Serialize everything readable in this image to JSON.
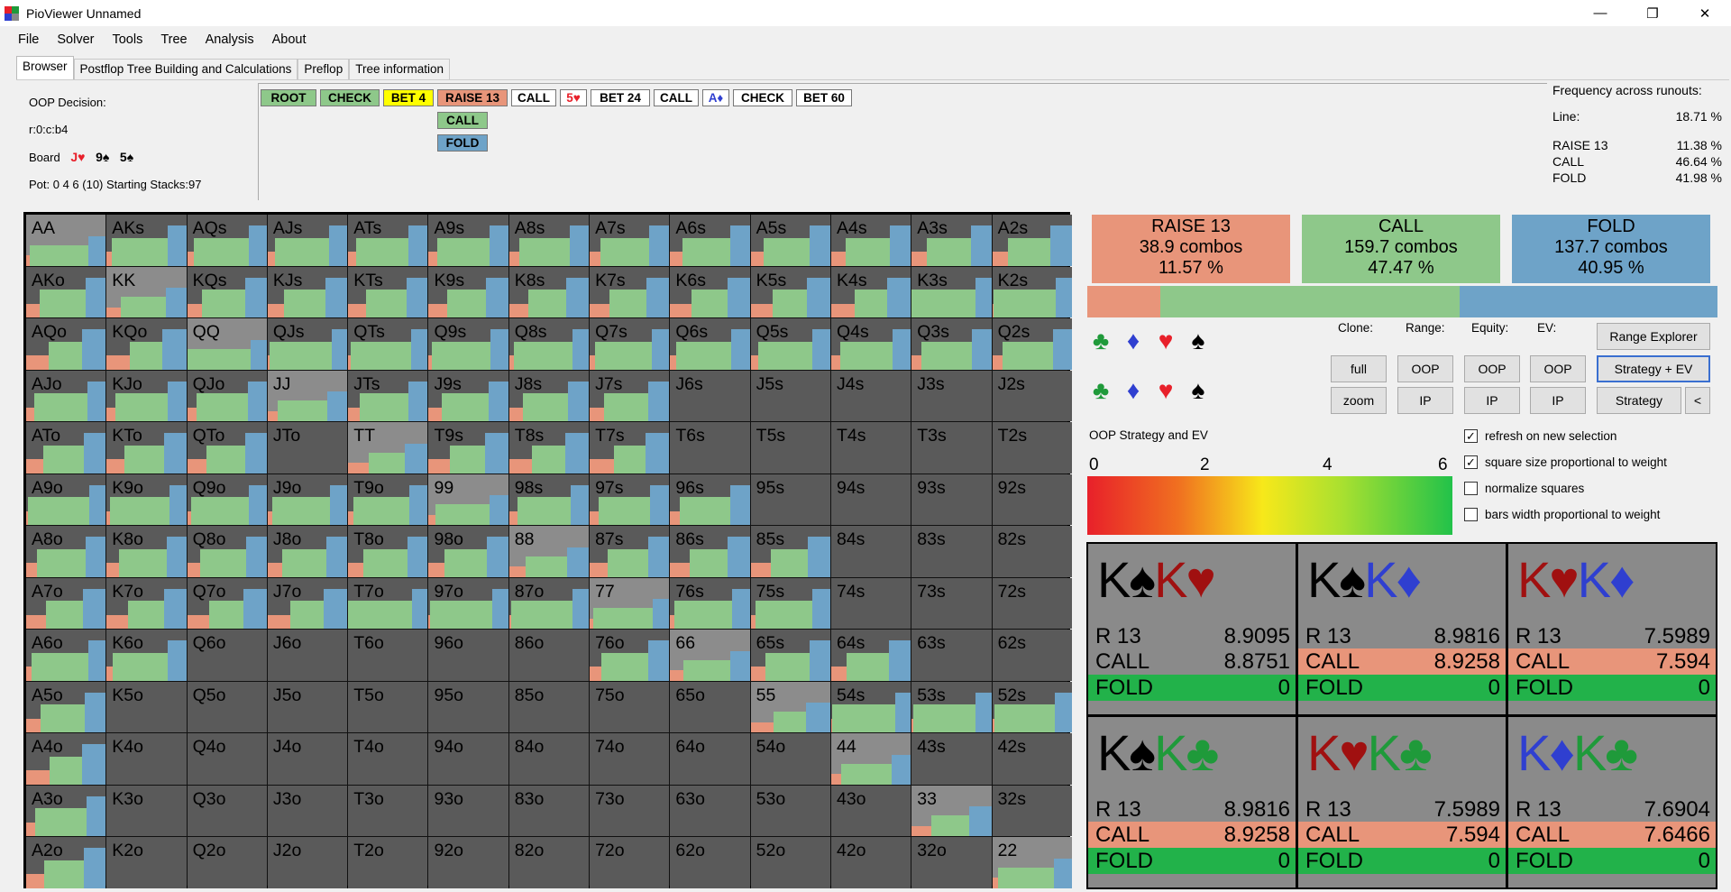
{
  "window": {
    "title": "PioViewer Unnamed",
    "minimize": "—",
    "restore": "❐",
    "close": "✕"
  },
  "menu": [
    "File",
    "Solver",
    "Tools",
    "Tree",
    "Analysis",
    "About"
  ],
  "tabs": [
    "Browser",
    "Postflop Tree Building and Calculations",
    "Preflop",
    "Tree information"
  ],
  "info": {
    "decision": "OOP Decision:",
    "line": "r:0:c:b4",
    "board_label": "Board",
    "board": [
      {
        "card": "J♥",
        "color": "#e8202a"
      },
      {
        "card": "9♠",
        "color": "#000000"
      },
      {
        "card": "5♠",
        "color": "#000000"
      }
    ],
    "pot": "Pot: 0 4 6 (10) Starting Stacks:97"
  },
  "path": [
    {
      "label": "ROOT",
      "bg": "#8ec88a",
      "fg": "#000000"
    },
    {
      "label": "CHECK",
      "bg": "#8ec88a",
      "fg": "#000000"
    },
    {
      "label": "BET 4",
      "bg": "#ffff00",
      "fg": "#000000"
    },
    {
      "label": "RAISE 13",
      "bg": "#e8957a",
      "fg": "#000000"
    },
    {
      "label": "CALL",
      "bg": "#ffffff",
      "fg": "#000000"
    },
    {
      "label": "5♥",
      "bg": "#ffffff",
      "fg": "#e8202a"
    },
    {
      "label": "BET 24",
      "bg": "#ffffff",
      "fg": "#000000"
    },
    {
      "label": "CALL",
      "bg": "#ffffff",
      "fg": "#000000"
    },
    {
      "label": "A♦",
      "bg": "#ffffff",
      "fg": "#2f3fd0"
    },
    {
      "label": "CHECK",
      "bg": "#ffffff",
      "fg": "#000000"
    },
    {
      "label": "BET 60",
      "bg": "#ffffff",
      "fg": "#000000"
    }
  ],
  "path_options": [
    {
      "label": "CALL",
      "bg": "#8ec88a"
    },
    {
      "label": "FOLD",
      "bg": "#6ea3c8"
    }
  ],
  "frequency": {
    "title": "Frequency across runouts:",
    "line_label": "Line:",
    "line_value": "18.71 %",
    "rows": [
      {
        "label": "RAISE 13",
        "value": "11.38 %"
      },
      {
        "label": "CALL",
        "value": "46.64 %"
      },
      {
        "label": "FOLD",
        "value": "41.98 %"
      }
    ]
  },
  "colors": {
    "raise": "#e8957a",
    "call": "#8ec88a",
    "fold": "#6ea3c8",
    "empty": "#5a5a5a",
    "weight": "#8c8c8c"
  },
  "matrix": [
    [
      "AA",
      "AKs",
      "AQs",
      "AJs",
      "ATs",
      "A9s",
      "A8s",
      "A7s",
      "A6s",
      "A5s",
      "A4s",
      "A3s",
      "A2s"
    ],
    [
      "AKo",
      "KK",
      "KQs",
      "KJs",
      "KTs",
      "K9s",
      "K8s",
      "K7s",
      "K6s",
      "K5s",
      "K4s",
      "K3s",
      "K2s"
    ],
    [
      "AQo",
      "KQo",
      "QQ",
      "QJs",
      "QTs",
      "Q9s",
      "Q8s",
      "Q7s",
      "Q6s",
      "Q5s",
      "Q4s",
      "Q3s",
      "Q2s"
    ],
    [
      "AJo",
      "KJo",
      "QJo",
      "JJ",
      "JTs",
      "J9s",
      "J8s",
      "J7s",
      "J6s",
      "J5s",
      "J4s",
      "J3s",
      "J2s"
    ],
    [
      "ATo",
      "KTo",
      "QTo",
      "JTo",
      "TT",
      "T9s",
      "T8s",
      "T7s",
      "T6s",
      "T5s",
      "T4s",
      "T3s",
      "T2s"
    ],
    [
      "A9o",
      "K9o",
      "Q9o",
      "J9o",
      "T9o",
      "99",
      "98s",
      "97s",
      "96s",
      "95s",
      "94s",
      "93s",
      "92s"
    ],
    [
      "A8o",
      "K8o",
      "Q8o",
      "J8o",
      "T8o",
      "98o",
      "88",
      "87s",
      "86s",
      "85s",
      "84s",
      "83s",
      "82s"
    ],
    [
      "A7o",
      "K7o",
      "Q7o",
      "J7o",
      "T7o",
      "97o",
      "87o",
      "77",
      "76s",
      "75s",
      "74s",
      "73s",
      "72s"
    ],
    [
      "A6o",
      "K6o",
      "Q6o",
      "J6o",
      "T6o",
      "96o",
      "86o",
      "76o",
      "66",
      "65s",
      "64s",
      "63s",
      "62s"
    ],
    [
      "A5o",
      "K5o",
      "Q5o",
      "J5o",
      "T5o",
      "95o",
      "85o",
      "75o",
      "65o",
      "55",
      "54s",
      "53s",
      "52s"
    ],
    [
      "A4o",
      "K4o",
      "Q4o",
      "J4o",
      "T4o",
      "94o",
      "84o",
      "74o",
      "64o",
      "54o",
      "44",
      "43s",
      "42s"
    ],
    [
      "A3o",
      "K3o",
      "Q3o",
      "J3o",
      "T3o",
      "93o",
      "83o",
      "73o",
      "63o",
      "53o",
      "43o",
      "33",
      "32s"
    ],
    [
      "A2o",
      "K2o",
      "Q2o",
      "J2o",
      "T2o",
      "92o",
      "82o",
      "72o",
      "62o",
      "52o",
      "42o",
      "32o",
      "22"
    ]
  ],
  "summary": [
    {
      "action": "RAISE 13",
      "combos": "38.9 combos",
      "pct": "11.57 %",
      "share": 0.1157
    },
    {
      "action": "CALL",
      "combos": "159.7 combos",
      "pct": "47.47 %",
      "share": 0.4747
    },
    {
      "action": "FOLD",
      "combos": "137.7 combos",
      "pct": "40.95 %",
      "share": 0.4095
    }
  ],
  "suits": [
    {
      "s": "♣",
      "c": "#1f9a3a"
    },
    {
      "s": "♦",
      "c": "#2f3fd0"
    },
    {
      "s": "♥",
      "c": "#e8202a"
    },
    {
      "s": "♠",
      "c": "#000000"
    }
  ],
  "controls": {
    "clone": "Clone:",
    "range": "Range:",
    "equity": "Equity:",
    "ev": "EV:",
    "full": "full",
    "zoom": "zoom",
    "oop": "OOP",
    "ip": "IP",
    "range_explorer": "Range Explorer",
    "strategy_ev": "Strategy + EV",
    "strategy": "Strategy",
    "back": "<"
  },
  "checkboxes": [
    {
      "label": "refresh on new selection",
      "checked": true
    },
    {
      "label": "square size proportional to weight",
      "checked": true
    },
    {
      "label": "normalize squares",
      "checked": false
    },
    {
      "label": "bars width proportional to weight",
      "checked": false
    }
  ],
  "check_mark": "✓",
  "legend_title": "OOP Strategy and EV",
  "gradient_ticks": [
    "0",
    "2",
    "4",
    "6"
  ],
  "combos_detail": [
    {
      "c1": "K",
      "s1": "♠",
      "col1": "#000000",
      "c2": "K",
      "s2": "♥",
      "col2": "#a01010",
      "rows": [
        {
          "a": "R 13",
          "v": "8.9095"
        },
        {
          "a": "CALL",
          "v": "8.8751"
        },
        {
          "a": "FOLD",
          "v": "0"
        }
      ],
      "callbar": 0.0
    },
    {
      "c1": "K",
      "s1": "♠",
      "col1": "#000000",
      "c2": "K",
      "s2": "♦",
      "col2": "#2f3fd0",
      "rows": [
        {
          "a": "R 13",
          "v": "8.9816"
        },
        {
          "a": "CALL",
          "v": "8.9258"
        },
        {
          "a": "FOLD",
          "v": "0"
        }
      ],
      "callbar": 1.0
    },
    {
      "c1": "K",
      "s1": "♥",
      "col1": "#a01010",
      "c2": "K",
      "s2": "♦",
      "col2": "#2f3fd0",
      "rows": [
        {
          "a": "R 13",
          "v": "7.5989"
        },
        {
          "a": "CALL",
          "v": "7.594"
        },
        {
          "a": "FOLD",
          "v": "0"
        }
      ],
      "callbar": 1.0
    },
    {
      "c1": "K",
      "s1": "♠",
      "col1": "#000000",
      "c2": "K",
      "s2": "♣",
      "col2": "#1f9a3a",
      "rows": [
        {
          "a": "R 13",
          "v": "8.9816"
        },
        {
          "a": "CALL",
          "v": "8.9258"
        },
        {
          "a": "FOLD",
          "v": "0"
        }
      ],
      "callbar": 1.0
    },
    {
      "c1": "K",
      "s1": "♥",
      "col1": "#a01010",
      "c2": "K",
      "s2": "♣",
      "col2": "#1f9a3a",
      "rows": [
        {
          "a": "R 13",
          "v": "7.5989"
        },
        {
          "a": "CALL",
          "v": "7.594"
        },
        {
          "a": "FOLD",
          "v": "0"
        }
      ],
      "callbar": 1.0
    },
    {
      "c1": "K",
      "s1": "♦",
      "col1": "#2f3fd0",
      "c2": "K",
      "s2": "♣",
      "col2": "#1f9a3a",
      "rows": [
        {
          "a": "R 13",
          "v": "7.6904"
        },
        {
          "a": "CALL",
          "v": "7.6466"
        },
        {
          "a": "FOLD",
          "v": "0"
        }
      ],
      "callbar": 1.0
    }
  ]
}
